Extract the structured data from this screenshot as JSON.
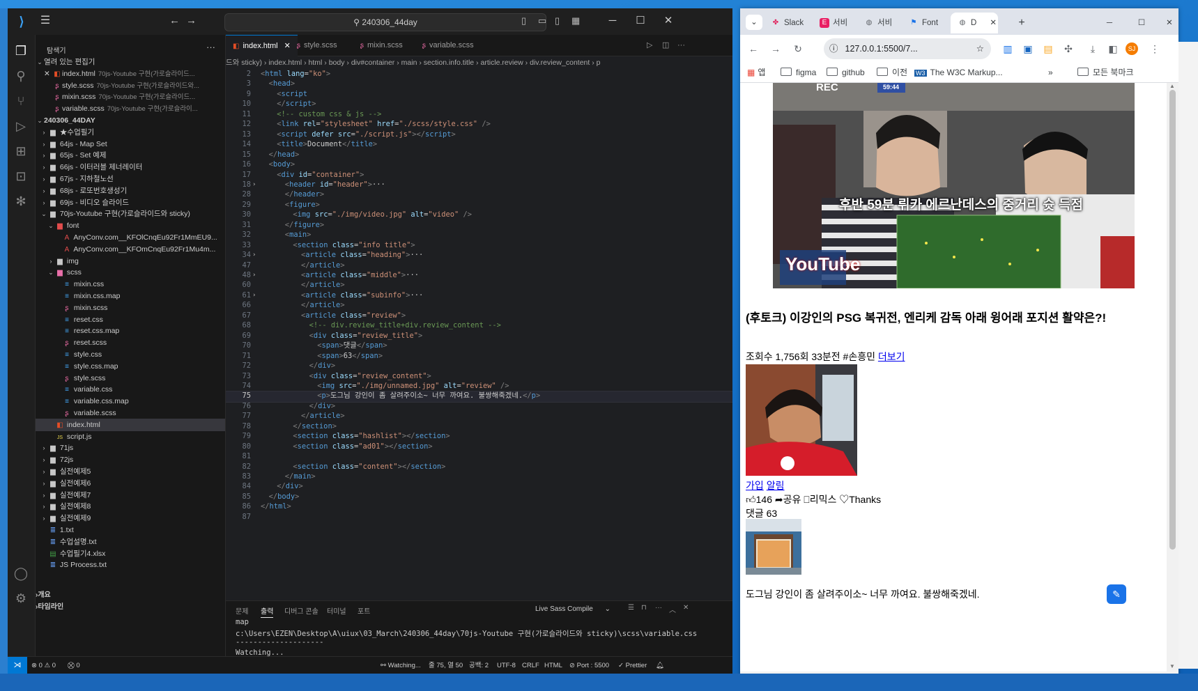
{
  "vscode": {
    "search": "240306_44day",
    "tabs": [
      {
        "label": "index.html",
        "active": true
      },
      {
        "label": "style.scss"
      },
      {
        "label": "mixin.scss"
      },
      {
        "label": "variable.scss"
      }
    ],
    "breadcrumb": [
      "드와 sticky)",
      "index.html",
      "html",
      "body",
      "div#container",
      "main",
      "section.info.title",
      "article.review",
      "div.review_content",
      "p"
    ],
    "explorer": {
      "header": "탐색기",
      "open_editors_label": "열려 있는 편집기",
      "open_editors": [
        {
          "name": "index.html",
          "desc": "70js-Youtube 구현(가로슬라이드..."
        },
        {
          "name": "style.scss",
          "desc": "70js-Youtube 구현(가로슬라이드와..."
        },
        {
          "name": "mixin.scss",
          "desc": "70js-Youtube 구현(가로슬라이드..."
        },
        {
          "name": "variable.scss",
          "desc": "70js-Youtube 구현(가로슬라이..."
        }
      ],
      "workspace": "240306_44DAY",
      "tree": [
        {
          "name": "★수업필기",
          "type": "folder",
          "indent": 1
        },
        {
          "name": "64js - Map Set",
          "type": "folder",
          "indent": 1
        },
        {
          "name": "65js - Set 예제",
          "type": "folder",
          "indent": 1
        },
        {
          "name": "66js - 이터러블 제너레이터",
          "type": "folder",
          "indent": 1
        },
        {
          "name": "67js - 지하철노선",
          "type": "folder",
          "indent": 1
        },
        {
          "name": "68js - 로또번호생성기",
          "type": "folder",
          "indent": 1
        },
        {
          "name": "69js - 비디오 슬라이드",
          "type": "folder",
          "indent": 1
        },
        {
          "name": "70js-Youtube 구현(가로슬라이드와 sticky)",
          "type": "folder-open",
          "indent": 1
        },
        {
          "name": "font",
          "type": "folder-open",
          "indent": 2
        },
        {
          "name": "AnyConv.com__KFOlCnqEu92Fr1MmEU9...",
          "type": "font",
          "indent": 3
        },
        {
          "name": "AnyConv.com__KFOmCnqEu92Fr1Mu4m...",
          "type": "font",
          "indent": 3
        },
        {
          "name": "img",
          "type": "folder",
          "indent": 2
        },
        {
          "name": "scss",
          "type": "folder-open",
          "indent": 2
        },
        {
          "name": "mixin.css",
          "type": "css",
          "indent": 3
        },
        {
          "name": "mixin.css.map",
          "type": "css",
          "indent": 3
        },
        {
          "name": "mixin.scss",
          "type": "scss",
          "indent": 3
        },
        {
          "name": "reset.css",
          "type": "css",
          "indent": 3
        },
        {
          "name": "reset.css.map",
          "type": "css",
          "indent": 3
        },
        {
          "name": "reset.scss",
          "type": "scss",
          "indent": 3
        },
        {
          "name": "style.css",
          "type": "css",
          "indent": 3
        },
        {
          "name": "style.css.map",
          "type": "css",
          "indent": 3
        },
        {
          "name": "style.scss",
          "type": "scss",
          "indent": 3
        },
        {
          "name": "variable.css",
          "type": "css",
          "indent": 3
        },
        {
          "name": "variable.css.map",
          "type": "css",
          "indent": 3
        },
        {
          "name": "variable.scss",
          "type": "scss",
          "indent": 3
        },
        {
          "name": "index.html",
          "type": "html",
          "indent": 2,
          "selected": true
        },
        {
          "name": "script.js",
          "type": "js",
          "indent": 2
        },
        {
          "name": "71js",
          "type": "folder",
          "indent": 1
        },
        {
          "name": "72js",
          "type": "folder",
          "indent": 1
        },
        {
          "name": "실전예제5",
          "type": "folder",
          "indent": 1
        },
        {
          "name": "실전예제6",
          "type": "folder",
          "indent": 1
        },
        {
          "name": "실전예제7",
          "type": "folder",
          "indent": 1
        },
        {
          "name": "실전예제8",
          "type": "folder",
          "indent": 1
        },
        {
          "name": "실전예제9",
          "type": "folder",
          "indent": 1
        },
        {
          "name": "1.txt",
          "type": "txt",
          "indent": 1
        },
        {
          "name": "수업설명.txt",
          "type": "txt",
          "indent": 1
        },
        {
          "name": "수업필기4.xlsx",
          "type": "xlsx",
          "indent": 1
        },
        {
          "name": "JS Process.txt",
          "type": "txt",
          "indent": 1
        }
      ],
      "outline_label": "개요",
      "timeline_label": "타임라인"
    },
    "code": [
      {
        "n": "2",
        "html": "<span class='g'>&lt;</span><span class='t'>html</span> <span class='a'>lang</span>=<span class='s'>\"ko\"</span><span class='g'>&gt;</span>",
        "indent": 0
      },
      {
        "n": "3",
        "html": "<span class='g'>&lt;</span><span class='t'>head</span><span class='g'>&gt;</span>",
        "indent": 1
      },
      {
        "n": "9",
        "html": "<span class='g'>&lt;</span><span class='t'>script</span>",
        "indent": 2
      },
      {
        "n": "10",
        "html": "<span class='g'>&lt;/</span><span class='t'>script</span><span class='g'>&gt;</span>",
        "indent": 2
      },
      {
        "n": "11",
        "html": "<span class='c'>&lt;!-- custom css &amp; js --&gt;</span>",
        "indent": 2
      },
      {
        "n": "12",
        "html": "<span class='g'>&lt;</span><span class='t'>link</span> <span class='a'>rel</span>=<span class='s'>\"stylesheet\"</span> <span class='a'>href</span>=<span class='s'>\"./scss/style.css\"</span> <span class='g'>/&gt;</span>",
        "indent": 2
      },
      {
        "n": "13",
        "html": "<span class='g'>&lt;</span><span class='t'>script</span> <span class='a'>defer</span> <span class='a'>src</span>=<span class='s'>\"./script.js\"</span><span class='g'>&gt;&lt;/</span><span class='t'>script</span><span class='g'>&gt;</span>",
        "indent": 2
      },
      {
        "n": "14",
        "html": "<span class='g'>&lt;</span><span class='t'>title</span><span class='g'>&gt;</span>Document<span class='g'>&lt;/</span><span class='t'>title</span><span class='g'>&gt;</span>",
        "indent": 2
      },
      {
        "n": "15",
        "html": "<span class='g'>&lt;/</span><span class='t'>head</span><span class='g'>&gt;</span>",
        "indent": 1
      },
      {
        "n": "16",
        "html": "<span class='g'>&lt;</span><span class='t'>body</span><span class='g'>&gt;</span>",
        "indent": 1
      },
      {
        "n": "17",
        "html": "<span class='g'>&lt;</span><span class='t'>div</span> <span class='a'>id</span>=<span class='s'>\"container\"</span><span class='g'>&gt;</span>",
        "indent": 2
      },
      {
        "n": "18",
        "html": "<span class='g'>&lt;</span><span class='t'>header</span> <span class='a'>id</span>=<span class='s'>\"header\"</span><span class='g'>&gt;</span>···",
        "indent": 3,
        "fold": true
      },
      {
        "n": "28",
        "html": "<span class='g'>&lt;/</span><span class='t'>header</span><span class='g'>&gt;</span>",
        "indent": 3
      },
      {
        "n": "29",
        "html": "<span class='g'>&lt;</span><span class='t'>figure</span><span class='g'>&gt;</span>",
        "indent": 3
      },
      {
        "n": "30",
        "html": "<span class='g'>&lt;</span><span class='t'>img</span> <span class='a'>src</span>=<span class='s'>\"./img/video.jpg\"</span> <span class='a'>alt</span>=<span class='s'>\"video\"</span> <span class='g'>/&gt;</span>",
        "indent": 4
      },
      {
        "n": "31",
        "html": "<span class='g'>&lt;/</span><span class='t'>figure</span><span class='g'>&gt;</span>",
        "indent": 3
      },
      {
        "n": "32",
        "html": "<span class='g'>&lt;</span><span class='t'>main</span><span class='g'>&gt;</span>",
        "indent": 3
      },
      {
        "n": "33",
        "html": "<span class='g'>&lt;</span><span class='t'>section</span> <span class='a'>class</span>=<span class='s'>\"info title\"</span><span class='g'>&gt;</span>",
        "indent": 4
      },
      {
        "n": "34",
        "html": "<span class='g'>&lt;</span><span class='t'>article</span> <span class='a'>class</span>=<span class='s'>\"heading\"</span><span class='g'>&gt;</span>···",
        "indent": 5,
        "fold": true
      },
      {
        "n": "47",
        "html": "<span class='g'>&lt;/</span><span class='t'>article</span><span class='g'>&gt;</span>",
        "indent": 5
      },
      {
        "n": "48",
        "html": "<span class='g'>&lt;</span><span class='t'>article</span> <span class='a'>class</span>=<span class='s'>\"middle\"</span><span class='g'>&gt;</span>···",
        "indent": 5,
        "fold": true
      },
      {
        "n": "60",
        "html": "<span class='g'>&lt;/</span><span class='t'>article</span><span class='g'>&gt;</span>",
        "indent": 5
      },
      {
        "n": "61",
        "html": "<span class='g'>&lt;</span><span class='t'>article</span> <span class='a'>class</span>=<span class='s'>\"subinfo\"</span><span class='g'>&gt;</span>···",
        "indent": 5,
        "fold": true
      },
      {
        "n": "66",
        "html": "<span class='g'>&lt;/</span><span class='t'>article</span><span class='g'>&gt;</span>",
        "indent": 5
      },
      {
        "n": "67",
        "html": "<span class='g'>&lt;</span><span class='t'>article</span> <span class='a'>class</span>=<span class='s'>\"review\"</span><span class='g'>&gt;</span>",
        "indent": 5
      },
      {
        "n": "68",
        "html": "<span class='c'>&lt;!-- div.review_title+div.review_content --&gt;</span>",
        "indent": 6
      },
      {
        "n": "69",
        "html": "<span class='g'>&lt;</span><span class='t'>div</span> <span class='a'>class</span>=<span class='s'>\"review_title\"</span><span class='g'>&gt;</span>",
        "indent": 6
      },
      {
        "n": "70",
        "html": "<span class='g'>&lt;</span><span class='t'>span</span><span class='g'>&gt;</span>댓글<span class='g'>&lt;/</span><span class='t'>span</span><span class='g'>&gt;</span>",
        "indent": 7
      },
      {
        "n": "71",
        "html": "<span class='g'>&lt;</span><span class='t'>span</span><span class='g'>&gt;</span>63<span class='g'>&lt;/</span><span class='t'>span</span><span class='g'>&gt;</span>",
        "indent": 7
      },
      {
        "n": "72",
        "html": "<span class='g'>&lt;/</span><span class='t'>div</span><span class='g'>&gt;</span>",
        "indent": 6
      },
      {
        "n": "73",
        "html": "<span class='g'>&lt;</span><span class='t'>div</span> <span class='a'>class</span>=<span class='s'>\"review_content\"</span><span class='g'>&gt;</span>",
        "indent": 6
      },
      {
        "n": "74",
        "html": "<span class='g'>&lt;</span><span class='t'>img</span> <span class='a'>src</span>=<span class='s'>\"./img/unnamed.jpg\"</span> <span class='a'>alt</span>=<span class='s'>\"review\"</span> <span class='g'>/&gt;</span>",
        "indent": 7
      },
      {
        "n": "75",
        "html": "<span class='g'>&lt;</span><span class='t'>p</span><span class='g'>&gt;</span>도그님 강인이 좀 살려주이소~ 너무 까여요. 불쌍해죽겠네.<span class='g'>&lt;/</span><span class='t'>p</span><span class='g'>&gt;</span>",
        "indent": 7,
        "current": true
      },
      {
        "n": "76",
        "html": "<span class='g'>&lt;/</span><span class='t'>div</span><span class='g'>&gt;</span>",
        "indent": 6
      },
      {
        "n": "77",
        "html": "<span class='g'>&lt;/</span><span class='t'>article</span><span class='g'>&gt;</span>",
        "indent": 5
      },
      {
        "n": "78",
        "html": "<span class='g'>&lt;/</span><span class='t'>section</span><span class='g'>&gt;</span>",
        "indent": 4
      },
      {
        "n": "79",
        "html": "<span class='g'>&lt;</span><span class='t'>section</span> <span class='a'>class</span>=<span class='s'>\"hashlist\"</span><span class='g'>&gt;&lt;/</span><span class='t'>section</span><span class='g'>&gt;</span>",
        "indent": 4
      },
      {
        "n": "80",
        "html": "<span class='g'>&lt;</span><span class='t'>section</span> <span class='a'>class</span>=<span class='s'>\"ad01\"</span><span class='g'>&gt;&lt;/</span><span class='t'>section</span><span class='g'>&gt;</span>",
        "indent": 4
      },
      {
        "n": "81",
        "html": "",
        "indent": 0
      },
      {
        "n": "82",
        "html": "<span class='g'>&lt;</span><span class='t'>section</span> <span class='a'>class</span>=<span class='s'>\"content\"</span><span class='g'>&gt;&lt;/</span><span class='t'>section</span><span class='g'>&gt;</span>",
        "indent": 4
      },
      {
        "n": "83",
        "html": "<span class='g'>&lt;/</span><span class='t'>main</span><span class='g'>&gt;</span>",
        "indent": 3
      },
      {
        "n": "84",
        "html": "<span class='g'>&lt;/</span><span class='t'>div</span><span class='g'>&gt;</span>",
        "indent": 2
      },
      {
        "n": "85",
        "html": "<span class='g'>&lt;/</span><span class='t'>body</span><span class='g'>&gt;</span>",
        "indent": 1
      },
      {
        "n": "86",
        "html": "<span class='g'>&lt;/</span><span class='t'>html</span><span class='g'>&gt;</span>",
        "indent": 0
      },
      {
        "n": "87",
        "html": "",
        "indent": 0
      }
    ],
    "panel": {
      "tabs": [
        "문제",
        "출력",
        "디버그 콘솔",
        "터미널",
        "포트"
      ],
      "active_tab": "출력",
      "channel": "Live Sass Compile",
      "lines": [
        "map",
        "c:\\Users\\EZEN\\Desktop\\A\\uiux\\03_March\\240306_44day\\70js-Youtube 구현(가로슬라이드와 sticky)\\scss\\variable.css",
        "--------------------",
        "Watching..."
      ]
    },
    "status": {
      "errors": "0",
      "warnings": "0",
      "ports": "0",
      "watching": "Watching...",
      "position": "줄 75, 열 50",
      "spaces": "공백: 2",
      "encoding": "UTF-8",
      "eol": "CRLF",
      "language": "HTML",
      "port": "Port : 5500",
      "prettier": "Prettier"
    }
  },
  "chrome": {
    "tabs": [
      {
        "label": "Slack",
        "icon": "slack-icon"
      },
      {
        "label": "서비",
        "icon": "e-icon"
      },
      {
        "label": "서비",
        "icon": "globe-icon"
      },
      {
        "label": "Font",
        "icon": "flag-icon"
      },
      {
        "label": "D",
        "icon": "globe-icon",
        "active": true
      }
    ],
    "url": "127.0.0.1:5500/7...",
    "profile_initials": "SJ",
    "bookmarks": [
      "앱",
      "figma",
      "github",
      "이전",
      "The W3C Markup...",
      "모든 북마크"
    ],
    "page": {
      "video_rec": "REC",
      "video_time": "59:44",
      "video_caption": "후반 59분 뤼카 에르난데스의 중거리 슛 득점",
      "video_logo": "YouTube",
      "title": "(후토크) 이강인의 PSG 복귀전, 엔리케 감독 아래 윙어래 포지션 활약은?!",
      "meta": "조회수 1,756회 33분전 #손흥민",
      "more_link": "더보기",
      "join_link": "가입",
      "alert_link": "알림",
      "likes": "146",
      "share": "공유",
      "remix": "리믹스",
      "thanks": "Thanks",
      "comments_label": "댓글 63",
      "review_text": "도그님 강인이 좀 살려주이소~ 너무 까여요. 불쌍해죽겠네."
    }
  }
}
